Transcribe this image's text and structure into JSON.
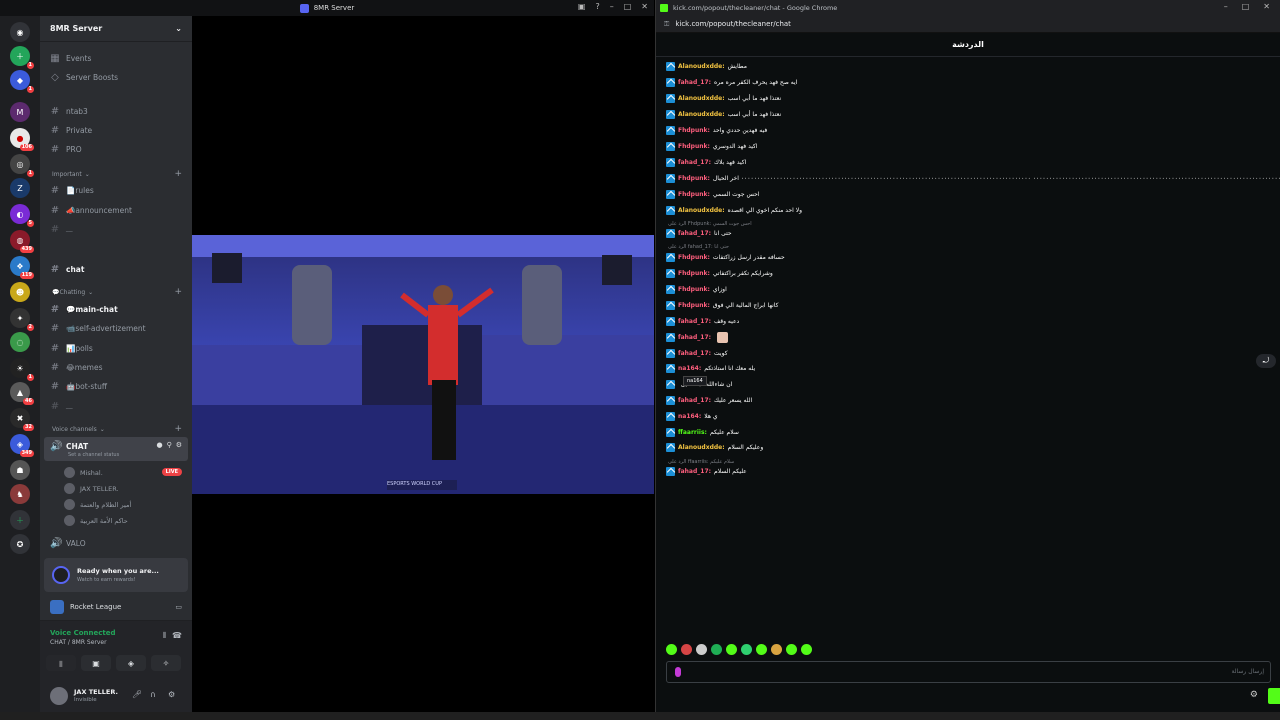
{
  "discord": {
    "window_title": "8MR Server",
    "server_name": "8MR Server",
    "guild_badges": [
      "1",
      "1",
      "106",
      "1",
      "5",
      "439",
      "119",
      "2",
      "1",
      "46",
      "32",
      "349"
    ],
    "channels": {
      "events": "Events",
      "server_boosts": "Server Boosts",
      "ntab3": "ntab3",
      "private": "Private",
      "pro": "PRO",
      "cat_important": "Important",
      "rules": "📄rules",
      "announcement": "📣announcement",
      "cat_chatting": "💬Chatting",
      "chat": "chat",
      "main_chat": "💬main-chat",
      "self_advertizement": "📹self-advertizement",
      "polls": "📊polls",
      "memes": "😂memes",
      "bot_stuff": "🤖bot-stuff",
      "cat_voice": "Voice channels",
      "voice_chat": "CHAT",
      "channel_status": "Set a channel status",
      "valo": "VALO"
    },
    "voice_users": [
      "Mishal.",
      "JAX TELLER.",
      "أمير الظلام والعتمة",
      "حاكم الأمة العربية"
    ],
    "live_label": "LIVE",
    "ready_title": "Ready when you are...",
    "ready_sub": "Watch to earn rewards!",
    "activity": "Rocket League",
    "voice_status": "Voice Connected",
    "voice_sub": "CHAT / 8MR Server",
    "user_name": "JAX TELLER.",
    "user_status": "Invisible",
    "colors": {
      "accent": "#5865f2",
      "online": "#23a55a",
      "live": "#ed4245"
    }
  },
  "chrome": {
    "window_title": "kick.com/popout/thecleaner/chat - Google Chrome",
    "url": "kick.com/popout/thecleaner/chat",
    "chat_title": "الدردشة",
    "messages": [
      {
        "user": "Alanoudxdde:",
        "text": "مطايش",
        "color": "#f5c542"
      },
      {
        "user": "fahad_17:",
        "text": "ايه صح فهد يحرف الكفر مره مره",
        "color": "#ff5f7e"
      },
      {
        "user": "Alanoudxdde:",
        "text": "نعتذا فهد ما أبي اسب",
        "color": "#f5c542"
      },
      {
        "user": "Alanoudxdde:",
        "text": "نعتذا فهد ما أبي اسب",
        "color": "#f5c542"
      },
      {
        "user": "Fhdpunk:",
        "text": "فيه فهدين حددي واحد",
        "color": "#ff5f7e"
      },
      {
        "user": "Fhdpunk:",
        "text": "اكيد فهد الدوسري",
        "color": "#ff5f7e"
      },
      {
        "user": "fahad_17:",
        "text": "اكيد فهد بلاك",
        "color": "#ff5f7e"
      },
      {
        "user": "Fhdpunk:",
        "text": "اخر الحيال ‎٠٠٠٠٠٠٠٠٠٠٠٠٠٠٠٠٠٠٠٠٠٠٠٠٠٠٠٠٠٠٠٠٠٠٠٠٠٠٠٠٠٠٠٠٠٠٠٠٠٠٠٠٠٠٠٠٠٠٠٠٠٠٠٠٠٠٠٠٠٠٠٠٠٠٠٠٠٠٠٠٠٠٠٠ ٠٠٠٠٠٠٠٠٠٠٠٠٠٠٠٠٠٠٠٠٠٠٠٠٠٠٠٠٠٠٠٠٠٠٠٠٠٠٠٠٠٠٠٠٠٠٠٠٠٠٠٠٠٠٠٠٠٠٠٠٠٠٠٠٠٠٠٠٠٠٠٠٠٠٠٠٠٠٠٠٠٠٠٠٠٠٠٠٠٠",
        "color": "#ff5f7e"
      },
      {
        "user": "Fhdpunk:",
        "text": "احس جوت السمي",
        "color": "#ff5f7e"
      },
      {
        "user": "Alanoudxdde:",
        "text": "ولا احد منكم اخوي الي اقصده",
        "color": "#f5c542"
      },
      {
        "user": "fahad_17:",
        "text": "حتى انا",
        "color": "#ff5f7e"
      },
      {
        "user": "Fhdpunk:",
        "text": "حسافه مقدر ارسل زراكتفات",
        "color": "#ff5f7e"
      },
      {
        "user": "Fhdpunk:",
        "text": "وشرايكم تكفر براكتفاتي",
        "color": "#ff5f7e"
      },
      {
        "user": "Fhdpunk:",
        "text": "اوزاي",
        "color": "#ff5f7e"
      },
      {
        "user": "Fhdpunk:",
        "text": "كانها ابراج المالية الي فوق",
        "color": "#ff5f7e"
      },
      {
        "user": "fahad_17:",
        "text": "دعيه وقف",
        "color": "#ff5f7e"
      },
      {
        "user": "fahad_17:",
        "text": "",
        "color": "#ff5f7e"
      },
      {
        "user": "fahad_17:",
        "text": "كويت",
        "color": "#ff5f7e"
      },
      {
        "user": "na164:",
        "text": "يله معك انا استاذتكم",
        "color": "#ff5f7e"
      },
      {
        "user": "",
        "text": "ان شاءالله ف القليل",
        "color": "#ff5f7e"
      },
      {
        "user": "fahad_17:",
        "text": "الله يسعر عليك",
        "color": "#ff5f7e"
      },
      {
        "user": "na164:",
        "text": "ي هلا",
        "color": "#ff5f7e"
      },
      {
        "user": "ffaarriis:",
        "text": "سلام عليكم",
        "color": "#53fc18"
      },
      {
        "user": "Alanoudxdde:",
        "text": "وعليكم السلام",
        "color": "#f5c542"
      },
      {
        "user": "fahad_17:",
        "text": "عليكم السلام",
        "color": "#ff5f7e"
      }
    ],
    "replies": [
      "الرد على Fhdpunk: احس جوت السمي",
      "الرد على fahad_17: حتى انا",
      "الرد على ffaarriis: سلام عليكم"
    ],
    "tooltip": "na164",
    "input_placeholder": "إرسال رسالة",
    "colors": {
      "kick_green": "#53fc18",
      "badge_blue": "#1c8fd6"
    }
  }
}
